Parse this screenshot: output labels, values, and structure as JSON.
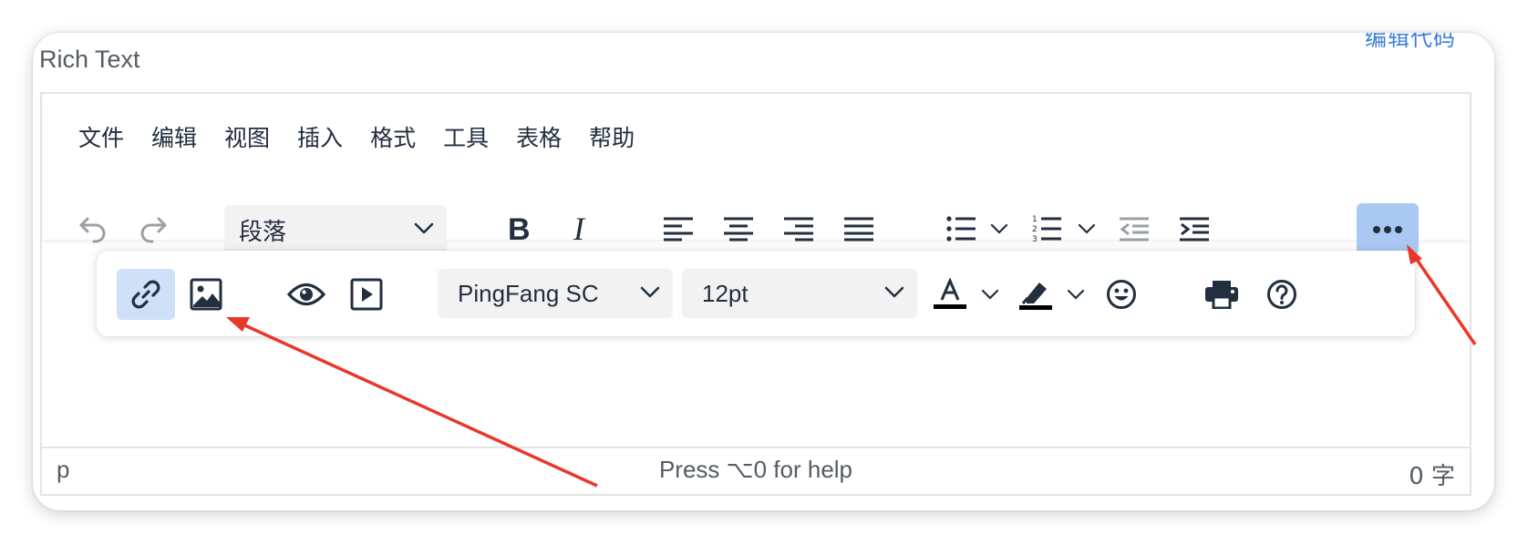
{
  "top_link": "编辑代码",
  "field_label": "Rich Text",
  "menubar": [
    "文件",
    "编辑",
    "视图",
    "插入",
    "格式",
    "工具",
    "表格",
    "帮助"
  ],
  "toolbar": {
    "block_format": "段落",
    "font_family": "PingFang SC",
    "font_size": "12pt"
  },
  "statusbar": {
    "path": "p",
    "help": "Press ⌥0 for help",
    "word_count": "0 字"
  },
  "colors": {
    "accent_active": "#a9c9f3",
    "icon": "#222f3e",
    "arrow": "#e8382a"
  },
  "icons": [
    "undo-icon",
    "redo-icon",
    "bold-icon",
    "italic-icon",
    "align-left-icon",
    "align-center-icon",
    "align-right-icon",
    "justify-icon",
    "bullet-list-icon",
    "numbered-list-icon",
    "outdent-icon",
    "indent-icon",
    "more-icon",
    "link-icon",
    "image-icon",
    "preview-icon",
    "media-icon",
    "text-color-icon",
    "highlight-icon",
    "emoji-icon",
    "print-icon",
    "help-icon"
  ]
}
